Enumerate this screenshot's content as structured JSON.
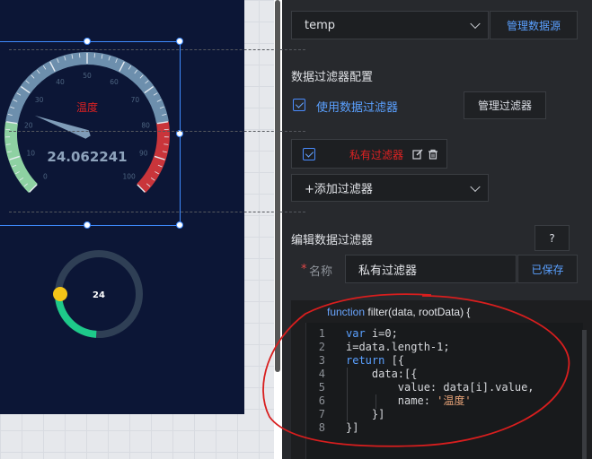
{
  "gauge": {
    "title": "温度",
    "value": 24.062241,
    "value_text": "24.062241",
    "min": 0,
    "max": 100,
    "ticks": [
      "0",
      "10",
      "20",
      "30",
      "40",
      "50",
      "60",
      "70",
      "80",
      "90",
      "100"
    ]
  },
  "ring": {
    "value_text": "24",
    "value": 24,
    "max": 100
  },
  "panel": {
    "datasource": {
      "selected": "temp",
      "manage_label": "管理数据源"
    },
    "filter_config": {
      "title": "数据过滤器配置",
      "use_filter_label": "使用数据过滤器",
      "manage_filters_label": "管理过滤器",
      "private_filter_label": "私有过滤器",
      "add_filter_label": "+添加过滤器"
    },
    "edit_filter": {
      "title": "编辑数据过滤器",
      "help_label": "?",
      "name_label": "名称",
      "name_required": "*",
      "name_value": "私有过滤器",
      "saved_label": "已保存"
    },
    "code": {
      "header_keyword": "function",
      "header_rest": " filter(data, rootData) {",
      "lines": [
        {
          "num": "1"
        },
        {
          "num": "2"
        },
        {
          "num": "3"
        },
        {
          "num": "4"
        },
        {
          "num": "5"
        },
        {
          "num": "6"
        },
        {
          "num": "7"
        },
        {
          "num": "8"
        }
      ]
    }
  },
  "colors": {
    "screen_bg": "#0c1636",
    "gauge_arc": "#6d8fad",
    "gauge_green": "#8ed1a2",
    "gauge_red": "#c9353b",
    "gauge_title": "#e02222",
    "ring_track": "#2f3f55",
    "ring_progress": "#1ec98a",
    "ring_knob": "#f5c518",
    "accent_blue": "#5aa0ff"
  }
}
